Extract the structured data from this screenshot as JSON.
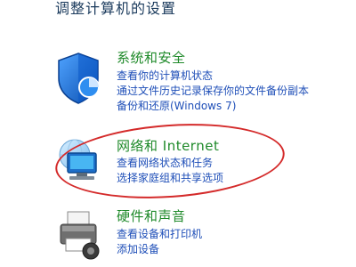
{
  "page": {
    "title": "调整计算机的设置"
  },
  "categories": {
    "system": {
      "heading": "系统和安全",
      "icon": "shield-icon",
      "links": [
        "查看你的计算机状态",
        "通过文件历史记录保存你的文件备份副本",
        "备份和还原(Windows 7)"
      ]
    },
    "network": {
      "heading": "网络和 Internet",
      "icon": "network-icon",
      "links": [
        "查看网络状态和任务",
        "选择家庭组和共享选项"
      ]
    },
    "hardware": {
      "heading": "硬件和声音",
      "icon": "printer-icon",
      "links": [
        "查看设备和打印机",
        "添加设备"
      ]
    }
  },
  "colors": {
    "heading_green": "#1f8a2a",
    "link_blue": "#1f4fb8",
    "highlight_red": "#d42a2a",
    "title_text": "#1a3a5c"
  }
}
